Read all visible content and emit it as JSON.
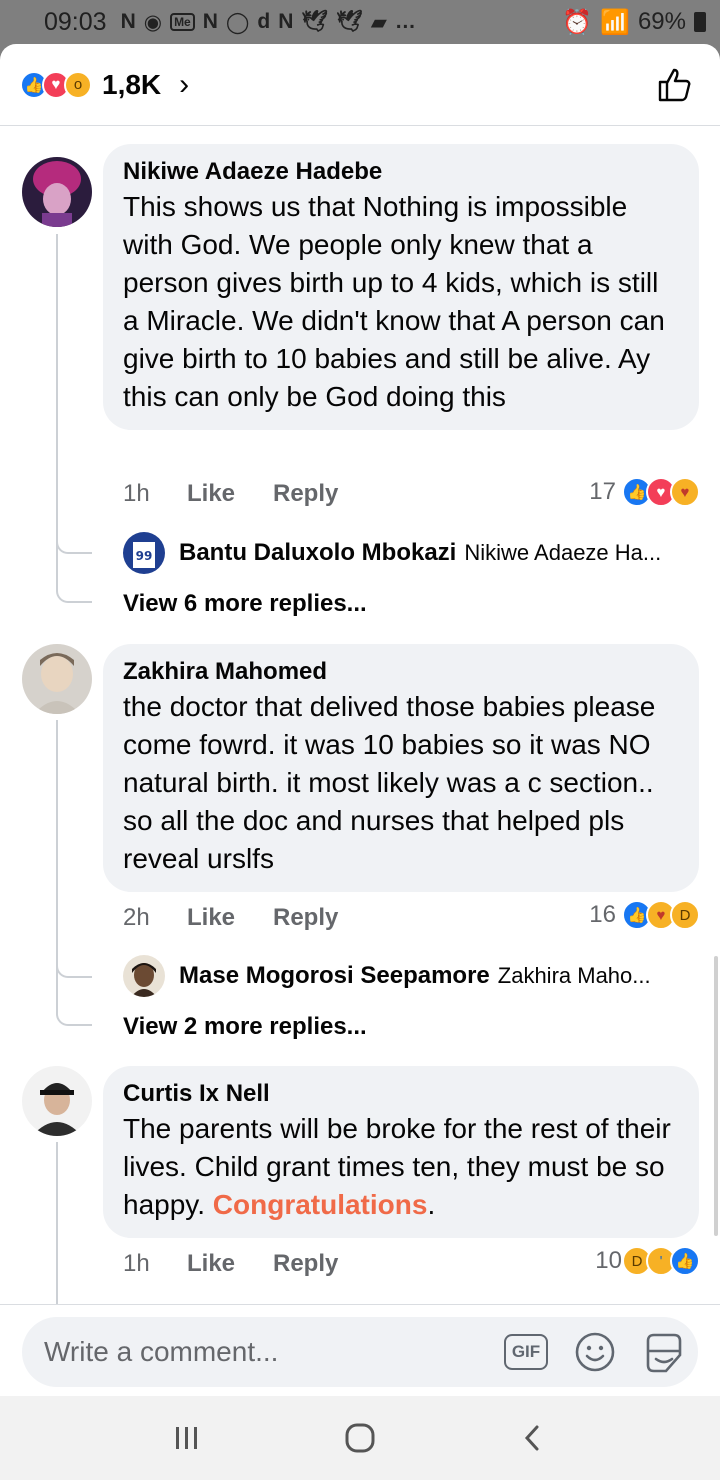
{
  "status_bar": {
    "time": "09:03",
    "notification_icons": [
      "N",
      "Me",
      "N",
      "d",
      "N",
      "…"
    ],
    "battery": "69%"
  },
  "reactions_header": {
    "count": "1,8K",
    "icons": [
      "like-icon",
      "love-icon",
      "wow-icon"
    ]
  },
  "comments": [
    {
      "author": "Nikiwe Adaeze Hadebe",
      "text": "This shows us that Nothing is impossible with God. We people only knew that a person gives birth up to 4 kids, which is still a Miracle. We didn't know that A person can give birth to 10 babies and still be alive. Ay this can only be God doing this",
      "time": "1h",
      "like_label": "Like",
      "reply_label": "Reply",
      "reaction_count": "17",
      "reaction_icons": [
        "like-icon",
        "love-icon",
        "care-icon"
      ],
      "reply_preview": {
        "name": "Bantu Daluxolo Mbokazi",
        "snippet": "Nikiwe Adaeze Ha..."
      },
      "more_replies": "View 6 more replies..."
    },
    {
      "author": "Zakhira Mahomed",
      "text": "the doctor that delived those babies please come fowrd. it was 10 babies so it was NO natural birth. it most likely was a c section.. so all the doc and nurses that helped pls reveal urslfs",
      "time": "2h",
      "like_label": "Like",
      "reply_label": "Reply",
      "reaction_count": "16",
      "reaction_icons": [
        "like-icon",
        "care-icon",
        "haha-icon"
      ],
      "reply_preview": {
        "name": "Mase Mogorosi Seepamore",
        "snippet": "Zakhira Maho..."
      },
      "more_replies": "View 2 more replies..."
    },
    {
      "author": "Curtis Ix Nell",
      "text_before": "The parents will be broke for the rest of their lives. Child grant times ten, they must be so happy. ",
      "highlight": "Congratulations",
      "text_after": ".",
      "time": "1h",
      "like_label": "Like",
      "reply_label": "Reply",
      "reaction_count": "10",
      "reaction_icons": [
        "haha-icon",
        "sad-icon",
        "like-icon"
      ]
    }
  ],
  "composer": {
    "placeholder": "Write a comment...",
    "gif_label": "GIF"
  },
  "colors": {
    "accent_blue": "#1877f2",
    "love_red": "#f33e58",
    "highlight_orange": "#f06a48",
    "bubble_bg": "#f0f2f5"
  }
}
